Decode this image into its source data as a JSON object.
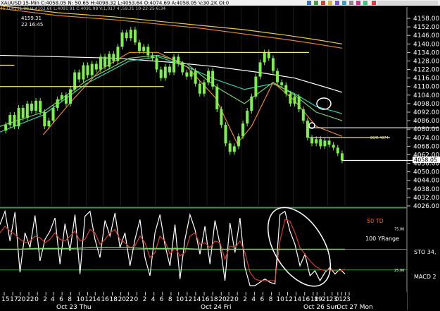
{
  "header": {
    "symbol": "XAUUSD",
    "timeframe": "15-Min",
    "ohlc": "C:4058.05  N:  50.65  H:4098.32  L:4053.64  O:4074.69  A:4058.05  V:30.2K  OI:0",
    "sub_row": "45  O:4101.99 H:4103.66 L:4091.91 C:4091.98 V:1,017 4159.31 10-22-25  6:34"
  },
  "annotations": {
    "high_value": "4159.31",
    "high_time": "22 16:45",
    "level_label": "80/R 4074",
    "price_label": "4058.05",
    "td_label": "50 TD",
    "yrange_label": "100 YRange",
    "sto_label": "STO  34,",
    "macd_label": "MACD 2"
  },
  "colors": {
    "background": "#000000",
    "candle": "#7ef04b",
    "level_line": "#f0e68c",
    "white_line": "#ffffff",
    "teal_ma": "#2fd2b0",
    "green_ma": "#7ccf6a",
    "orange_ma": "#e8852c",
    "gold_ma": "#e8c84a",
    "stoch_red": "#d93b2b",
    "grid_dark": "#1b1b1b",
    "td_orange": "#e86b1a"
  },
  "chart_data": [
    {
      "type": "candlestick",
      "ylim": [
        4026,
        4160
      ],
      "y_ticks": [
        "4158.00",
        "4152.00",
        "4146.00",
        "4140.00",
        "4134.00",
        "4128.00",
        "4122.00",
        "4116.00",
        "4110.00",
        "4104.00",
        "4098.00",
        "4092.00",
        "4086.00",
        "4080.00",
        "4074.00",
        "4068.00",
        "4062.00",
        "4056.00",
        "4050.00",
        "4044.00",
        "4038.00",
        "4032.00",
        "4026.00"
      ],
      "y_tick_values": [
        4158,
        4152,
        4146,
        4140,
        4134,
        4128,
        4122,
        4116,
        4110,
        4104,
        4098,
        4092,
        4086,
        4080,
        4074,
        4068,
        4062,
        4056,
        4050,
        4044,
        4038,
        4032,
        4026
      ],
      "close_path": [
        [
          0,
          4079
        ],
        [
          4,
          4083
        ],
        [
          7,
          4090
        ],
        [
          10,
          4082
        ],
        [
          13,
          4095
        ],
        [
          16,
          4088
        ],
        [
          19,
          4098
        ],
        [
          22,
          4093
        ],
        [
          25,
          4100
        ],
        [
          28,
          4092
        ],
        [
          31,
          4082
        ],
        [
          34,
          4086
        ],
        [
          37,
          4095
        ],
        [
          40,
          4101
        ],
        [
          43,
          4104
        ],
        [
          46,
          4098
        ],
        [
          49,
          4108
        ],
        [
          52,
          4120
        ],
        [
          55,
          4115
        ],
        [
          58,
          4125
        ],
        [
          61,
          4118
        ],
        [
          64,
          4126
        ],
        [
          67,
          4122
        ],
        [
          70,
          4131
        ],
        [
          73,
          4124
        ],
        [
          76,
          4133
        ],
        [
          79,
          4128
        ],
        [
          82,
          4138
        ],
        [
          85,
          4148
        ],
        [
          88,
          4144
        ],
        [
          91,
          4150
        ],
        [
          94,
          4141
        ],
        [
          97,
          4135
        ],
        [
          100,
          4138
        ],
        [
          103,
          4132
        ],
        [
          106,
          4130
        ],
        [
          109,
          4122
        ],
        [
          112,
          4116
        ],
        [
          115,
          4124
        ],
        [
          118,
          4120
        ],
        [
          121,
          4131
        ],
        [
          124,
          4126
        ],
        [
          127,
          4120
        ],
        [
          130,
          4117
        ],
        [
          133,
          4121
        ],
        [
          136,
          4112
        ],
        [
          139,
          4105
        ],
        [
          142,
          4113
        ],
        [
          145,
          4121
        ],
        [
          148,
          4110
        ],
        [
          151,
          4094
        ],
        [
          154,
          4083
        ],
        [
          157,
          4070
        ],
        [
          160,
          4064
        ],
        [
          163,
          4068
        ],
        [
          166,
          4075
        ],
        [
          169,
          4084
        ],
        [
          172,
          4093
        ],
        [
          175,
          4103
        ],
        [
          178,
          4117
        ],
        [
          181,
          4127
        ],
        [
          184,
          4134
        ],
        [
          187,
          4130
        ],
        [
          190,
          4121
        ],
        [
          193,
          4113
        ],
        [
          196,
          4111
        ],
        [
          199,
          4105
        ],
        [
          202,
          4098
        ],
        [
          205,
          4103
        ],
        [
          208,
          4094
        ],
        [
          211,
          4086
        ],
        [
          214,
          4074
        ],
        [
          217,
          4070
        ],
        [
          220,
          4073
        ],
        [
          223,
          4068
        ],
        [
          226,
          4072
        ],
        [
          229,
          4069
        ],
        [
          232,
          4067
        ],
        [
          235,
          4063
        ],
        [
          238,
          4058
        ]
      ],
      "series": [
        {
          "name": "",
          "color_key": "white_line",
          "points": [
            [
              0,
              4132
            ],
            [
              40,
              4131
            ],
            [
              80,
              4130
            ],
            [
              120,
              4127
            ],
            [
              150,
              4124
            ],
            [
              180,
              4120
            ],
            [
              205,
              4116
            ],
            [
              225,
              4110
            ],
            [
              238,
              4106
            ]
          ]
        },
        {
          "name": "",
          "color_key": "orange_ma",
          "points": [
            [
              0,
              4165
            ],
            [
              40,
              4160
            ],
            [
              80,
              4157
            ],
            [
              110,
              4154
            ],
            [
              140,
              4151
            ],
            [
              170,
              4147
            ],
            [
              200,
              4143
            ],
            [
              220,
              4140
            ],
            [
              238,
              4137
            ]
          ]
        },
        {
          "name": "",
          "color_key": "gold_ma",
          "points": [
            [
              0,
              4167
            ],
            [
              40,
              4162
            ],
            [
              80,
              4159
            ],
            [
              110,
              4156
            ],
            [
              140,
              4153
            ],
            [
              170,
              4150
            ],
            [
              200,
              4146
            ],
            [
              220,
              4143
            ],
            [
              238,
              4140
            ]
          ]
        },
        {
          "name": "",
          "color_key": "teal_ma",
          "points": [
            [
              0,
              4078
            ],
            [
              30,
              4090
            ],
            [
              60,
              4112
            ],
            [
              90,
              4128
            ],
            [
              110,
              4131
            ],
            [
              130,
              4124
            ],
            [
              150,
              4115
            ],
            [
              170,
              4108
            ],
            [
              190,
              4112
            ],
            [
              205,
              4105
            ],
            [
              220,
              4096
            ],
            [
              238,
              4091
            ]
          ]
        },
        {
          "name": "",
          "color_key": "green_ma",
          "points": [
            [
              0,
              4082
            ],
            [
              30,
              4092
            ],
            [
              60,
              4114
            ],
            [
              90,
              4130
            ],
            [
              110,
              4132
            ],
            [
              130,
              4126
            ],
            [
              150,
              4110
            ],
            [
              170,
              4098
            ],
            [
              190,
              4113
            ],
            [
              205,
              4104
            ],
            [
              220,
              4092
            ],
            [
              238,
              4086
            ]
          ]
        },
        {
          "name": "",
          "color_key": "orange_ma",
          "points": [
            [
              30,
              4076
            ],
            [
              50,
              4100
            ],
            [
              70,
              4122
            ],
            [
              90,
              4134
            ],
            [
              110,
              4134
            ],
            [
              130,
              4124
            ],
            [
              150,
              4102
            ],
            [
              165,
              4070
            ],
            [
              175,
              4082
            ],
            [
              190,
              4113
            ],
            [
              205,
              4100
            ],
            [
              220,
              4082
            ],
            [
              238,
              4075
            ]
          ]
        }
      ],
      "level_lines": [
        {
          "value": 4110,
          "x_from": 0,
          "x_to": 114
        },
        {
          "value": 4125,
          "x_from": 0,
          "x_to": 10
        },
        {
          "value": 4134,
          "x_from": 114,
          "x_to": 215
        },
        {
          "value": 4081,
          "x_from": 215,
          "x_to": 276
        },
        {
          "value": 4074,
          "x_from": 215,
          "x_to": 242
        },
        {
          "value": 4058,
          "x_from": 238,
          "x_to": 290
        }
      ]
    },
    {
      "type": "line",
      "ylim": [
        0,
        100
      ],
      "y_ticks": [
        "75.00",
        "25.00"
      ],
      "y_tick_values": [
        75,
        25
      ],
      "hlines": [
        100,
        50,
        25
      ],
      "x_ticks": [
        "15",
        "17",
        "20",
        "22",
        "0",
        "2",
        "4",
        "6",
        "8",
        "10",
        "12",
        "14",
        "16",
        "18",
        "20",
        "22",
        "0",
        "2",
        "4",
        "6",
        "8",
        "10",
        "12",
        "14",
        "16",
        "18",
        "20",
        "22",
        "0",
        "2",
        "4",
        "6",
        "8",
        "10",
        "12",
        "14",
        "16",
        "18",
        "19",
        "21",
        "23",
        "0",
        "1",
        "2",
        "3"
      ],
      "x_tick_values": [
        0,
        9,
        17,
        26,
        35,
        44,
        52,
        61,
        70,
        79,
        88,
        96,
        105,
        114,
        123,
        131,
        140,
        149,
        158,
        167,
        176,
        184,
        193,
        202,
        211,
        220,
        229,
        237,
        246,
        255,
        264,
        273,
        282,
        290,
        299,
        308,
        317,
        326,
        330,
        338,
        346,
        352,
        356,
        360,
        364
      ],
      "day_labels": [
        "Oct 23 Thu",
        "Oct 24 Fri",
        "Oct 26 Sun",
        "Oct 27 Mon"
      ],
      "series": [
        {
          "name": "",
          "color_key": "white_line",
          "values": [
            80,
            96,
            60,
            95,
            22,
            70,
            52,
            91,
            36,
            62,
            72,
            88,
            32,
            81,
            48,
            92,
            20,
            90,
            96,
            62,
            40,
            85,
            66,
            94,
            52,
            70,
            30,
            62,
            86,
            40,
            18,
            70,
            92,
            55,
            30,
            80,
            14,
            62,
            92,
            74,
            44,
            78,
            32,
            85,
            56,
            12,
            82,
            46,
            88,
            28,
            6,
            6,
            10,
            14,
            10,
            8,
            92,
            96,
            72,
            56,
            30,
            44,
            18,
            24,
            12,
            22,
            28,
            20,
            26,
            20
          ]
        },
        {
          "name": "",
          "color_key": "stoch_red",
          "values": [
            70,
            78,
            72,
            68,
            62,
            58,
            60,
            66,
            64,
            58,
            62,
            70,
            62,
            60,
            66,
            72,
            60,
            62,
            74,
            70,
            56,
            62,
            70,
            74,
            62,
            58,
            52,
            54,
            66,
            58,
            40,
            46,
            66,
            60,
            44,
            52,
            42,
            46,
            66,
            70,
            56,
            58,
            52,
            60,
            58,
            38,
            54,
            52,
            60,
            46,
            22,
            14,
            12,
            12,
            12,
            12,
            60,
            86,
            84,
            70,
            52,
            44,
            36,
            30,
            26,
            24,
            26,
            24,
            24,
            26
          ]
        },
        {
          "name": "",
          "color_key": "green_ma",
          "values": [
            50,
            50,
            51,
            51,
            51,
            52,
            52,
            52,
            51,
            51,
            51,
            50,
            50,
            50,
            50,
            50,
            50,
            50,
            50,
            50
          ]
        }
      ]
    }
  ]
}
